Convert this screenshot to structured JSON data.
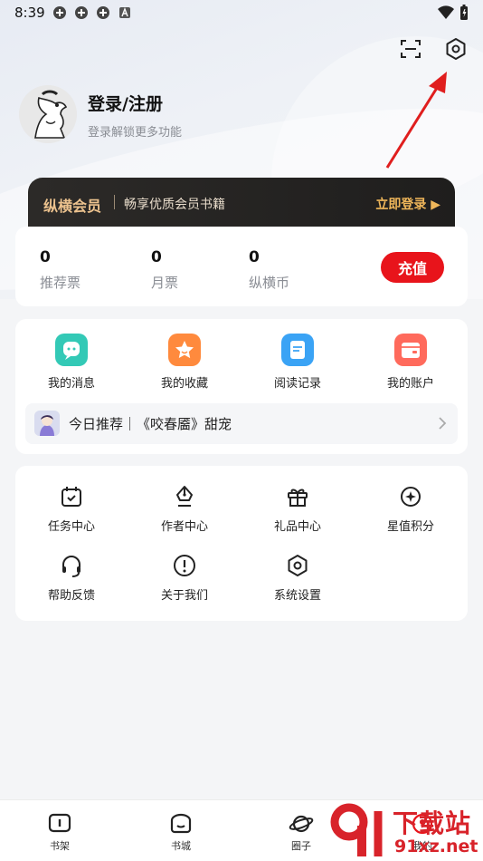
{
  "status_bar": {
    "time": "8:39"
  },
  "header": {
    "scan_icon": "scan-icon",
    "settings_icon": "settings-icon"
  },
  "profile": {
    "title": "登录/注册",
    "subtitle": "登录解锁更多功能"
  },
  "vip": {
    "name": "纵横会员",
    "description": "畅享优质会员书籍",
    "login": "立即登录 ▶"
  },
  "wallet": {
    "stats": [
      {
        "value": "0",
        "label": "推荐票"
      },
      {
        "value": "0",
        "label": "月票"
      },
      {
        "value": "0",
        "label": "纵横币"
      }
    ],
    "recharge": "充值"
  },
  "features": {
    "items": [
      {
        "label": "我的消息",
        "icon": "message-icon",
        "color": "#33c9b6"
      },
      {
        "label": "我的收藏",
        "icon": "star-icon",
        "color": "#ff8a3d"
      },
      {
        "label": "阅读记录",
        "icon": "document-icon",
        "color": "#3aa3f5"
      },
      {
        "label": "我的账户",
        "icon": "wallet-icon",
        "color": "#ff6a5c"
      }
    ],
    "recommend": {
      "text": "今日推荐｜《咬春靥》甜宠"
    }
  },
  "services": {
    "items": [
      {
        "label": "任务中心",
        "icon": "calendar-check-icon"
      },
      {
        "label": "作者中心",
        "icon": "pen-icon"
      },
      {
        "label": "礼品中心",
        "icon": "gift-icon"
      },
      {
        "label": "星值积分",
        "icon": "star-diamond-icon"
      },
      {
        "label": "帮助反馈",
        "icon": "headset-icon"
      },
      {
        "label": "关于我们",
        "icon": "info-icon"
      },
      {
        "label": "系统设置",
        "icon": "settings-icon"
      }
    ]
  },
  "bottom_nav": {
    "items": [
      {
        "label": "书架",
        "icon": "bookshelf-icon"
      },
      {
        "label": "书城",
        "icon": "bookstore-icon"
      },
      {
        "label": "圈子",
        "icon": "planet-icon"
      },
      {
        "label": "我的",
        "icon": "profile-icon"
      }
    ]
  },
  "watermark": {
    "title": "下载站",
    "url": "91xz.net"
  },
  "colors": {
    "accent": "#e8141b",
    "vip_gold": "#ecc28e",
    "vip_bg": "#2c2a28"
  }
}
